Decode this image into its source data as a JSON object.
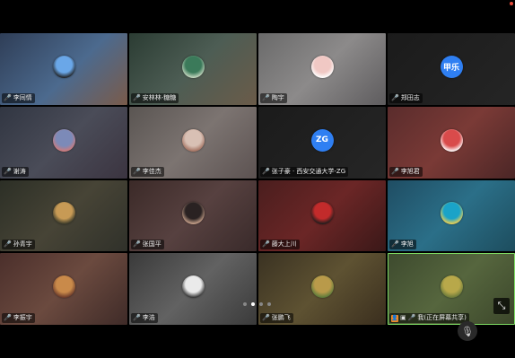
{
  "pager": {
    "pages": 4,
    "current": 2
  },
  "participants": [
    {
      "name": "李同情",
      "bg": "linear-gradient(135deg,#2f3e57,#4c6a8e 55%,#7a5b4a)",
      "avatar": {
        "type": "photo",
        "colors": [
          "#6aa7e8",
          "#222"
        ]
      }
    },
    {
      "name": "安林林-糖糖",
      "bg": "linear-gradient(135deg,#2b3c33,#4d5d54 50%,#6b5b49)",
      "avatar": {
        "type": "photo",
        "colors": [
          "#3b7a5a",
          "#c8d9c2"
        ]
      }
    },
    {
      "name": "陶宇",
      "bg": "linear-gradient(135deg,#6a6a6a,#8c8a8a 50%,#5e5c5e)",
      "avatar": {
        "type": "photo",
        "colors": [
          "#f0c8c4",
          "#fff"
        ]
      }
    },
    {
      "name": "郑田志",
      "bg": "linear-gradient(135deg,#1b1b1b,#252525)",
      "avatar": {
        "type": "initials",
        "text": "甲乐",
        "colors": [
          "#2f7ff2",
          "#2f7ff2"
        ]
      }
    },
    {
      "name": "谢涛",
      "bg": "linear-gradient(135deg,#313642,#4a4c58 50%,#3b3440)",
      "avatar": {
        "type": "photo",
        "colors": [
          "#7c8ab8",
          "#d07a7a"
        ]
      }
    },
    {
      "name": "李佳杰",
      "bg": "linear-gradient(135deg,#5a5552,#7c7471 50%,#5c5251)",
      "avatar": {
        "type": "photo",
        "colors": [
          "#d8c0b4",
          "#a37160"
        ]
      }
    },
    {
      "name": "张子豪 · 西安交通大学-ZG",
      "bg": "linear-gradient(135deg,#1b1b1b,#262626)",
      "avatar": {
        "type": "initials",
        "text": "ZG",
        "colors": [
          "#2f7ff2",
          "#2f7ff2"
        ]
      }
    },
    {
      "name": "李旭君",
      "bg": "linear-gradient(135deg,#5a2c2c,#7a3a36 50%,#4b2626)",
      "avatar": {
        "type": "photo",
        "colors": [
          "#d94b4b",
          "#fff"
        ]
      }
    },
    {
      "name": "孙青宇",
      "bg": "linear-gradient(135deg,#2c2f26,#474436 50%,#30312a)",
      "avatar": {
        "type": "photo",
        "colors": [
          "#c79a55",
          "#3a3a2a"
        ]
      }
    },
    {
      "name": "张国平",
      "bg": "linear-gradient(135deg,#3b2a28,#574140 50%,#392a2a)",
      "avatar": {
        "type": "photo",
        "colors": [
          "#2a2222",
          "#c9a38c"
        ]
      }
    },
    {
      "name": "藤大上川",
      "bg": "linear-gradient(135deg,#4a1e1e,#6b2626 50%,#3a1818)",
      "avatar": {
        "type": "photo",
        "colors": [
          "#c22b2b",
          "#1d1d1d"
        ]
      }
    },
    {
      "name": "李旭",
      "bg": "linear-gradient(135deg,#1f4d63,#2b6f88 50%,#1d4d5e)",
      "avatar": {
        "type": "photo",
        "colors": [
          "#1aa3c8",
          "#f0d050"
        ]
      }
    },
    {
      "name": "李振宇",
      "bg": "linear-gradient(135deg,#4b2f2b,#6b4a3f 50%,#3f2b28)",
      "avatar": {
        "type": "photo",
        "colors": [
          "#c98a4a",
          "#6b3a2a"
        ]
      }
    },
    {
      "name": "李浩",
      "bg": "linear-gradient(135deg,#3a3a3a,#626262 50%,#3a3a3a)",
      "avatar": {
        "type": "photo",
        "colors": [
          "#eaeaea",
          "#333"
        ]
      }
    },
    {
      "name": "张鹏飞",
      "bg": "linear-gradient(135deg,#3a3222,#5e5232 50%,#3a2e1e)",
      "avatar": {
        "type": "photo",
        "colors": [
          "#b99a4a",
          "#5a7a3a"
        ]
      }
    },
    {
      "name": "我(正在屏幕共享)",
      "bg": "linear-gradient(135deg,#3d4a2e,#56663e 50%,#3b462a)",
      "avatar": {
        "type": "photo",
        "colors": [
          "#b8a84a",
          "#6a7a3a"
        ]
      },
      "self": true
    }
  ]
}
